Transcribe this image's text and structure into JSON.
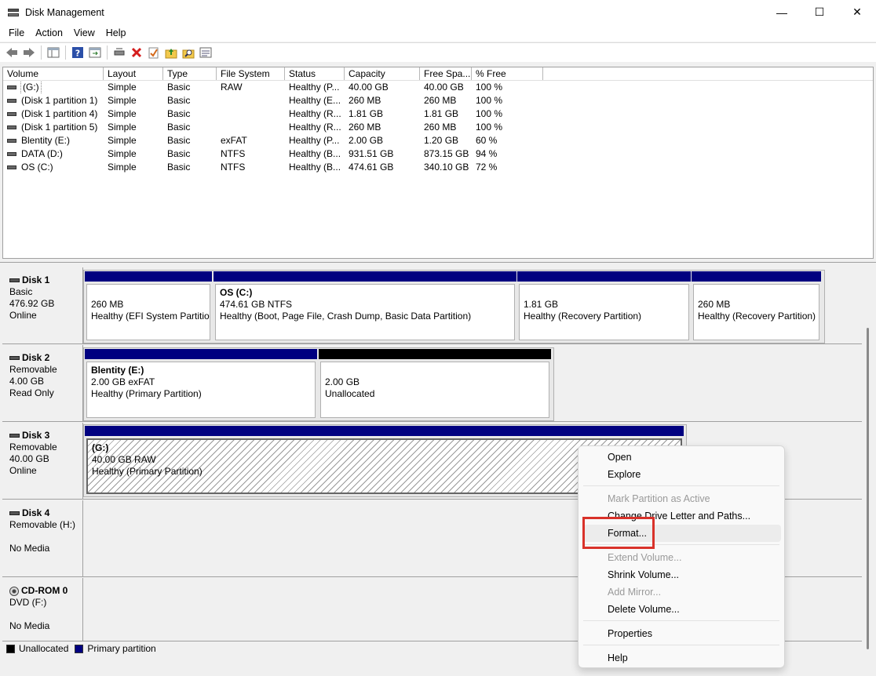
{
  "window": {
    "title": "Disk Management",
    "minimize": "—",
    "maximize": "☐",
    "close": "✕"
  },
  "menu": [
    "File",
    "Action",
    "View",
    "Help"
  ],
  "toolbar": [
    "back-icon",
    "forward-icon",
    "console-tree-icon",
    "help-icon",
    "refresh-icon",
    "connect-icon",
    "delete-icon",
    "check-icon",
    "folder-up-icon",
    "search-icon",
    "properties-icon"
  ],
  "volume_list": {
    "columns": [
      "Volume",
      "Layout",
      "Type",
      "File System",
      "Status",
      "Capacity",
      "Free Spa...",
      "% Free"
    ],
    "rows": [
      [
        "(G:)",
        "Simple",
        "Basic",
        "RAW",
        "Healthy (P...",
        "40.00 GB",
        "40.00 GB",
        "100 %"
      ],
      [
        "(Disk 1 partition 1)",
        "Simple",
        "Basic",
        "",
        "Healthy (E...",
        "260 MB",
        "260 MB",
        "100 %"
      ],
      [
        "(Disk 1 partition 4)",
        "Simple",
        "Basic",
        "",
        "Healthy (R...",
        "1.81 GB",
        "1.81 GB",
        "100 %"
      ],
      [
        "(Disk 1 partition 5)",
        "Simple",
        "Basic",
        "",
        "Healthy (R...",
        "260 MB",
        "260 MB",
        "100 %"
      ],
      [
        "Blentity (E:)",
        "Simple",
        "Basic",
        "exFAT",
        "Healthy (P...",
        "2.00 GB",
        "1.20 GB",
        "60 %"
      ],
      [
        "DATA (D:)",
        "Simple",
        "Basic",
        "NTFS",
        "Healthy (B...",
        "931.51 GB",
        "873.15 GB",
        "94 %"
      ],
      [
        "OS (C:)",
        "Simple",
        "Basic",
        "NTFS",
        "Healthy (B...",
        "474.61 GB",
        "340.10 GB",
        "72 %"
      ]
    ]
  },
  "disks": [
    {
      "name": "Disk 1",
      "type": "Basic",
      "size": "476.92 GB",
      "status": "Online",
      "partitions": [
        {
          "title": "",
          "line1": "260 MB",
          "line2": "Healthy (EFI System Partition)"
        },
        {
          "title": "OS  (C:)",
          "line1": "474.61 GB NTFS",
          "line2": "Healthy (Boot, Page File, Crash Dump, Basic Data Partition)"
        },
        {
          "title": "",
          "line1": "1.81 GB",
          "line2": "Healthy (Recovery Partition)"
        },
        {
          "title": "",
          "line1": "260 MB",
          "line2": "Healthy (Recovery Partition)"
        }
      ]
    },
    {
      "name": "Disk 2",
      "type": "Removable",
      "size": "4.00 GB",
      "status": "Read Only",
      "partitions": [
        {
          "title": "Blentity  (E:)",
          "line1": "2.00 GB exFAT",
          "line2": "Healthy (Primary Partition)"
        },
        {
          "title": "",
          "line1": "2.00 GB",
          "line2": "Unallocated"
        }
      ]
    },
    {
      "name": "Disk 3",
      "type": "Removable",
      "size": "40.00 GB",
      "status": "Online",
      "partitions": [
        {
          "title": "(G:)",
          "line1": "40.00 GB RAW",
          "line2": "Healthy (Primary Partition)"
        }
      ]
    },
    {
      "name": "Disk 4",
      "type": "Removable (H:)",
      "size": "",
      "status": "No Media",
      "partitions": []
    },
    {
      "name": "CD-ROM 0",
      "type": "DVD (F:)",
      "size": "",
      "status": "No Media",
      "partitions": []
    }
  ],
  "legend": {
    "unallocated": "Unallocated",
    "primary": "Primary partition",
    "unallocated_color": "#000000",
    "primary_color": "#000080"
  },
  "context_menu": {
    "open": "Open",
    "explore": "Explore",
    "mark_active": "Mark Partition as Active",
    "change_letter": "Change Drive Letter and Paths...",
    "format": "Format...",
    "extend": "Extend Volume...",
    "shrink": "Shrink Volume...",
    "add_mirror": "Add Mirror...",
    "delete": "Delete Volume...",
    "properties": "Properties",
    "help": "Help"
  }
}
